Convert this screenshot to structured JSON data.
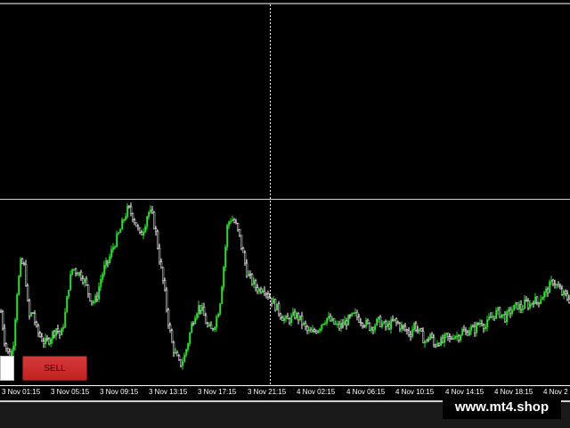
{
  "colors": {
    "background": "#000000",
    "bull_candle": "#33dd33",
    "bear_candle": "#ffffff",
    "grid": "#ffffff",
    "sell_button": "#c32121",
    "buy_button": "#ffffff"
  },
  "trading_panel": {
    "buy_label": "",
    "sell_label": "SELL"
  },
  "time_axis": {
    "labels": [
      "3 Nov 01:15",
      "3 Nov 05:15",
      "3 Nov 09:15",
      "3 Nov 13:15",
      "3 Nov 17:15",
      "3 Nov 21:15",
      "4 Nov 02:15",
      "4 Nov 06:15",
      "4 Nov 10:15",
      "4 Nov 14:15",
      "4 Nov 18:15",
      "4 Nov 2"
    ]
  },
  "watermark": "www.mt4.shop",
  "chart_data": {
    "type": "candlestick",
    "crosshair": true,
    "grid": false,
    "price_trace": [
      0.72,
      0.62,
      0.58,
      0.6,
      0.78,
      0.88,
      0.86,
      0.7,
      0.72,
      0.66,
      0.64,
      0.62,
      0.63,
      0.65,
      0.67,
      0.64,
      0.7,
      0.8,
      0.86,
      0.85,
      0.84,
      0.82,
      0.78,
      0.75,
      0.76,
      0.82,
      0.86,
      0.88,
      0.92,
      0.95,
      0.98,
      1.02,
      1.05,
      1.03,
      1.0,
      0.96,
      0.99,
      1.04,
      1.03,
      0.97,
      0.88,
      0.8,
      0.7,
      0.62,
      0.58,
      0.55,
      0.57,
      0.62,
      0.68,
      0.72,
      0.74,
      0.71,
      0.67,
      0.66,
      0.69,
      0.74,
      0.86,
      1.0,
      1.02,
      1.0,
      0.96,
      0.9,
      0.84,
      0.82,
      0.8,
      0.79,
      0.8,
      0.78,
      0.76,
      0.74,
      0.72,
      0.7,
      0.69,
      0.7,
      0.71,
      0.7,
      0.68,
      0.66,
      0.65,
      0.66,
      0.67,
      0.69,
      0.7,
      0.69,
      0.68,
      0.67,
      0.68,
      0.69,
      0.7,
      0.71,
      0.7,
      0.69,
      0.68,
      0.67,
      0.68,
      0.69,
      0.68,
      0.67,
      0.68,
      0.69,
      0.68,
      0.67,
      0.66,
      0.65,
      0.68,
      0.66,
      0.64,
      0.62,
      0.65,
      0.61,
      0.63,
      0.62,
      0.64,
      0.63,
      0.65,
      0.64,
      0.66,
      0.65,
      0.67,
      0.66,
      0.68,
      0.69,
      0.67,
      0.7,
      0.71,
      0.72,
      0.71,
      0.7,
      0.72,
      0.73,
      0.74,
      0.73,
      0.75,
      0.74,
      0.76,
      0.75,
      0.77,
      0.78,
      0.8,
      0.82,
      0.8,
      0.78,
      0.77,
      0.76
    ]
  }
}
